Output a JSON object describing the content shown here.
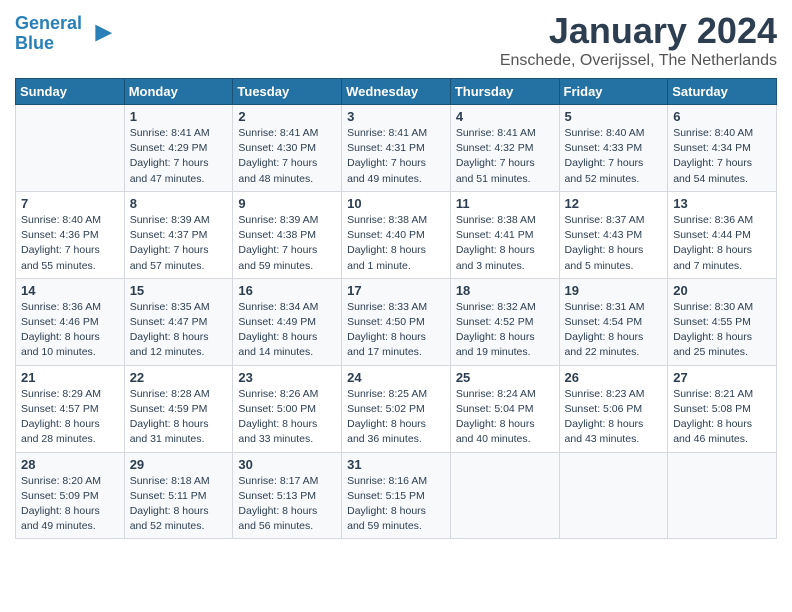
{
  "logo": {
    "line1": "General",
    "line2": "Blue"
  },
  "title": "January 2024",
  "subtitle": "Enschede, Overijssel, The Netherlands",
  "weekdays": [
    "Sunday",
    "Monday",
    "Tuesday",
    "Wednesday",
    "Thursday",
    "Friday",
    "Saturday"
  ],
  "weeks": [
    [
      {
        "day": "",
        "info": ""
      },
      {
        "day": "1",
        "info": "Sunrise: 8:41 AM\nSunset: 4:29 PM\nDaylight: 7 hours\nand 47 minutes."
      },
      {
        "day": "2",
        "info": "Sunrise: 8:41 AM\nSunset: 4:30 PM\nDaylight: 7 hours\nand 48 minutes."
      },
      {
        "day": "3",
        "info": "Sunrise: 8:41 AM\nSunset: 4:31 PM\nDaylight: 7 hours\nand 49 minutes."
      },
      {
        "day": "4",
        "info": "Sunrise: 8:41 AM\nSunset: 4:32 PM\nDaylight: 7 hours\nand 51 minutes."
      },
      {
        "day": "5",
        "info": "Sunrise: 8:40 AM\nSunset: 4:33 PM\nDaylight: 7 hours\nand 52 minutes."
      },
      {
        "day": "6",
        "info": "Sunrise: 8:40 AM\nSunset: 4:34 PM\nDaylight: 7 hours\nand 54 minutes."
      }
    ],
    [
      {
        "day": "7",
        "info": "Sunrise: 8:40 AM\nSunset: 4:36 PM\nDaylight: 7 hours\nand 55 minutes."
      },
      {
        "day": "8",
        "info": "Sunrise: 8:39 AM\nSunset: 4:37 PM\nDaylight: 7 hours\nand 57 minutes."
      },
      {
        "day": "9",
        "info": "Sunrise: 8:39 AM\nSunset: 4:38 PM\nDaylight: 7 hours\nand 59 minutes."
      },
      {
        "day": "10",
        "info": "Sunrise: 8:38 AM\nSunset: 4:40 PM\nDaylight: 8 hours\nand 1 minute."
      },
      {
        "day": "11",
        "info": "Sunrise: 8:38 AM\nSunset: 4:41 PM\nDaylight: 8 hours\nand 3 minutes."
      },
      {
        "day": "12",
        "info": "Sunrise: 8:37 AM\nSunset: 4:43 PM\nDaylight: 8 hours\nand 5 minutes."
      },
      {
        "day": "13",
        "info": "Sunrise: 8:36 AM\nSunset: 4:44 PM\nDaylight: 8 hours\nand 7 minutes."
      }
    ],
    [
      {
        "day": "14",
        "info": "Sunrise: 8:36 AM\nSunset: 4:46 PM\nDaylight: 8 hours\nand 10 minutes."
      },
      {
        "day": "15",
        "info": "Sunrise: 8:35 AM\nSunset: 4:47 PM\nDaylight: 8 hours\nand 12 minutes."
      },
      {
        "day": "16",
        "info": "Sunrise: 8:34 AM\nSunset: 4:49 PM\nDaylight: 8 hours\nand 14 minutes."
      },
      {
        "day": "17",
        "info": "Sunrise: 8:33 AM\nSunset: 4:50 PM\nDaylight: 8 hours\nand 17 minutes."
      },
      {
        "day": "18",
        "info": "Sunrise: 8:32 AM\nSunset: 4:52 PM\nDaylight: 8 hours\nand 19 minutes."
      },
      {
        "day": "19",
        "info": "Sunrise: 8:31 AM\nSunset: 4:54 PM\nDaylight: 8 hours\nand 22 minutes."
      },
      {
        "day": "20",
        "info": "Sunrise: 8:30 AM\nSunset: 4:55 PM\nDaylight: 8 hours\nand 25 minutes."
      }
    ],
    [
      {
        "day": "21",
        "info": "Sunrise: 8:29 AM\nSunset: 4:57 PM\nDaylight: 8 hours\nand 28 minutes."
      },
      {
        "day": "22",
        "info": "Sunrise: 8:28 AM\nSunset: 4:59 PM\nDaylight: 8 hours\nand 31 minutes."
      },
      {
        "day": "23",
        "info": "Sunrise: 8:26 AM\nSunset: 5:00 PM\nDaylight: 8 hours\nand 33 minutes."
      },
      {
        "day": "24",
        "info": "Sunrise: 8:25 AM\nSunset: 5:02 PM\nDaylight: 8 hours\nand 36 minutes."
      },
      {
        "day": "25",
        "info": "Sunrise: 8:24 AM\nSunset: 5:04 PM\nDaylight: 8 hours\nand 40 minutes."
      },
      {
        "day": "26",
        "info": "Sunrise: 8:23 AM\nSunset: 5:06 PM\nDaylight: 8 hours\nand 43 minutes."
      },
      {
        "day": "27",
        "info": "Sunrise: 8:21 AM\nSunset: 5:08 PM\nDaylight: 8 hours\nand 46 minutes."
      }
    ],
    [
      {
        "day": "28",
        "info": "Sunrise: 8:20 AM\nSunset: 5:09 PM\nDaylight: 8 hours\nand 49 minutes."
      },
      {
        "day": "29",
        "info": "Sunrise: 8:18 AM\nSunset: 5:11 PM\nDaylight: 8 hours\nand 52 minutes."
      },
      {
        "day": "30",
        "info": "Sunrise: 8:17 AM\nSunset: 5:13 PM\nDaylight: 8 hours\nand 56 minutes."
      },
      {
        "day": "31",
        "info": "Sunrise: 8:16 AM\nSunset: 5:15 PM\nDaylight: 8 hours\nand 59 minutes."
      },
      {
        "day": "",
        "info": ""
      },
      {
        "day": "",
        "info": ""
      },
      {
        "day": "",
        "info": ""
      }
    ]
  ]
}
